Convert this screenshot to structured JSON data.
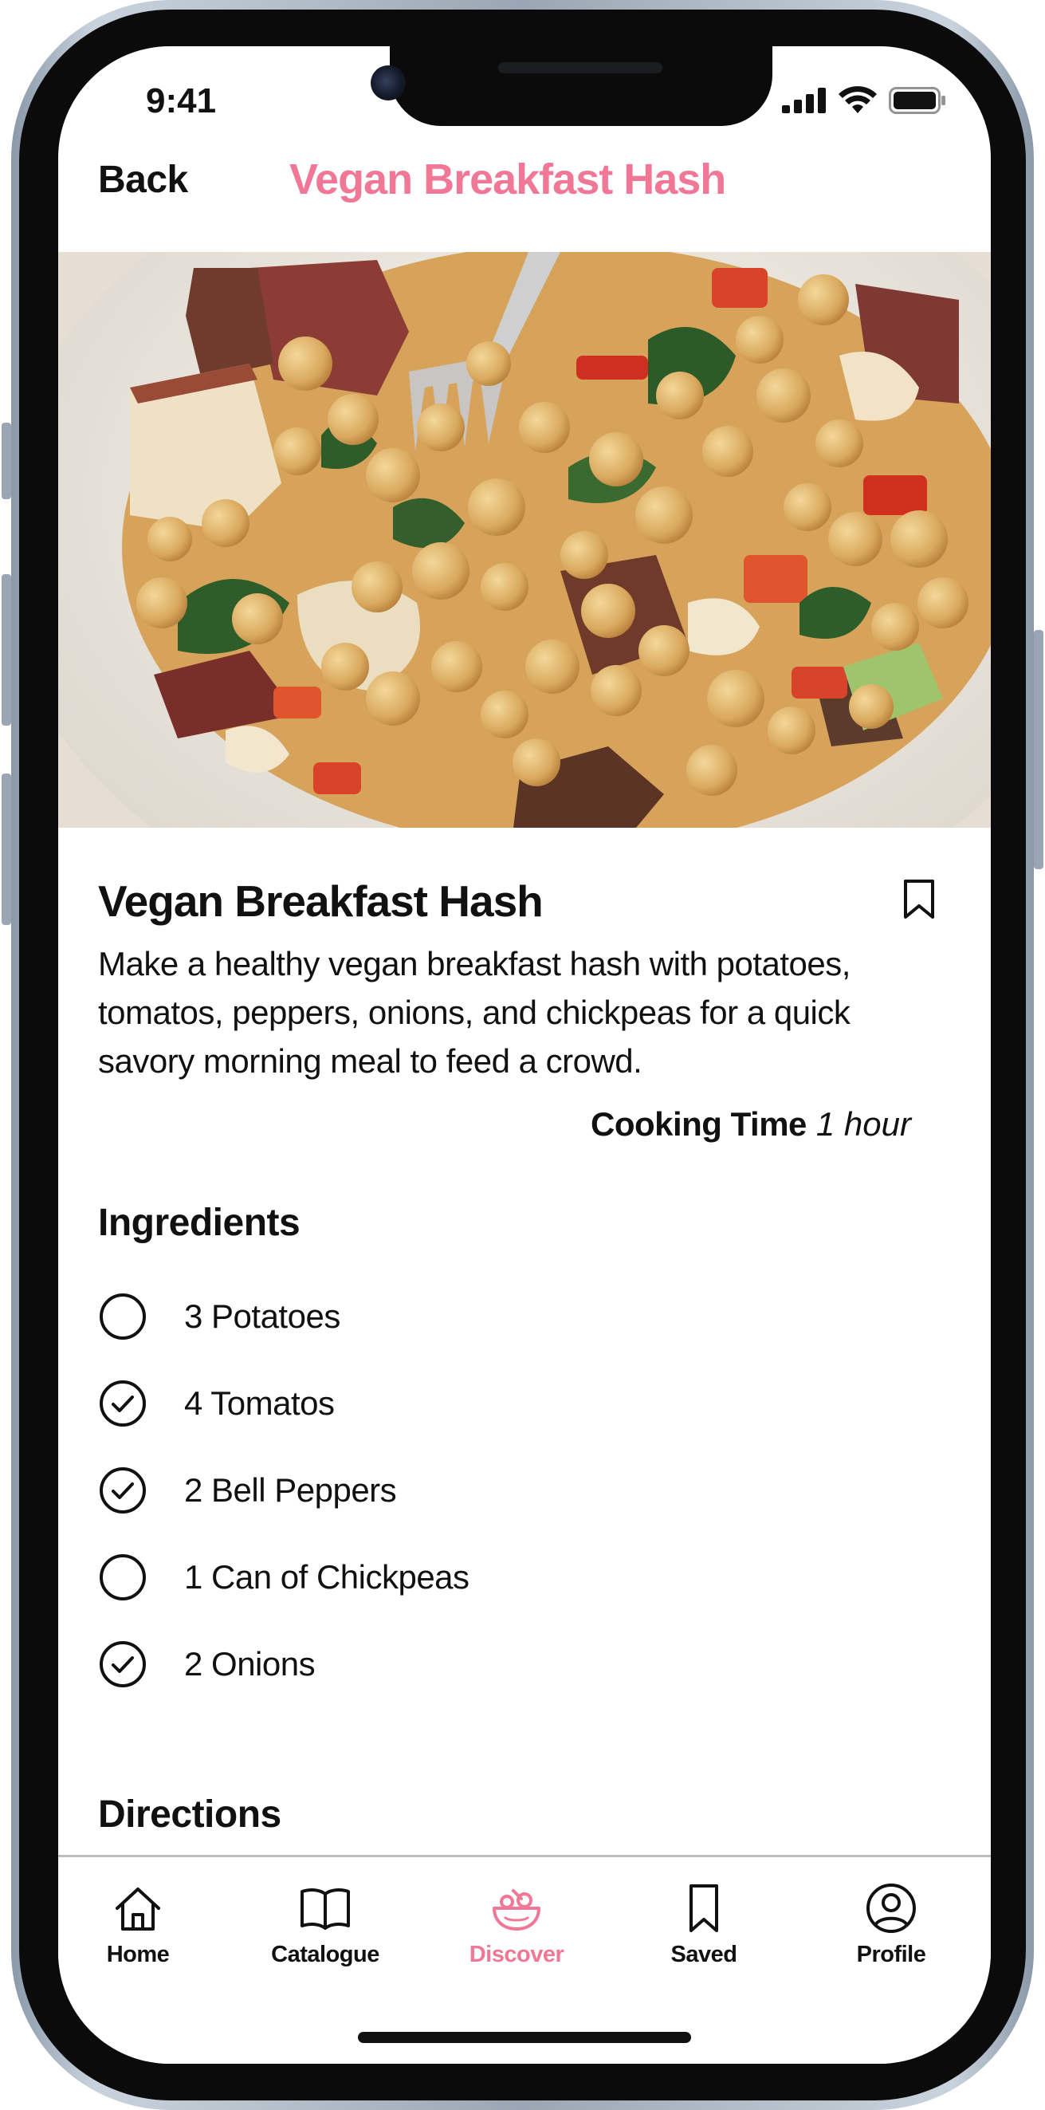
{
  "status_bar": {
    "time": "9:41"
  },
  "nav": {
    "back_label": "Back",
    "title": "Vegan Breakfast Hash"
  },
  "hero": {
    "image_alt": "Vegan Breakfast Hash"
  },
  "recipe": {
    "title": "Vegan Breakfast Hash",
    "description": "Make a healthy vegan breakfast hash with potatoes, tomatos, peppers, onions,  and chickpeas for a quick savory morning meal to feed a crowd.",
    "cooking_time_label": "Cooking Time",
    "cooking_time_value": "1 hour"
  },
  "ingredients": {
    "heading": "Ingredients",
    "items": [
      {
        "label": "3 Potatoes",
        "checked": false
      },
      {
        "label": "4 Tomatos",
        "checked": true
      },
      {
        "label": "2 Bell Peppers",
        "checked": true
      },
      {
        "label": "1 Can of Chickpeas",
        "checked": false
      },
      {
        "label": "2 Onions",
        "checked": true
      }
    ]
  },
  "directions": {
    "heading": "Directions"
  },
  "tab_bar": {
    "items": [
      {
        "label": "Home",
        "icon": "home-icon",
        "active": false
      },
      {
        "label": "Catalogue",
        "icon": "book-icon",
        "active": false
      },
      {
        "label": "Discover",
        "icon": "bowl-icon",
        "active": true
      },
      {
        "label": "Saved",
        "icon": "bookmark-icon",
        "active": false
      },
      {
        "label": "Profile",
        "icon": "profile-icon",
        "active": false
      }
    ]
  },
  "colors": {
    "accent": "#f07896",
    "text": "#111111",
    "divider": "#bdbdbd"
  }
}
